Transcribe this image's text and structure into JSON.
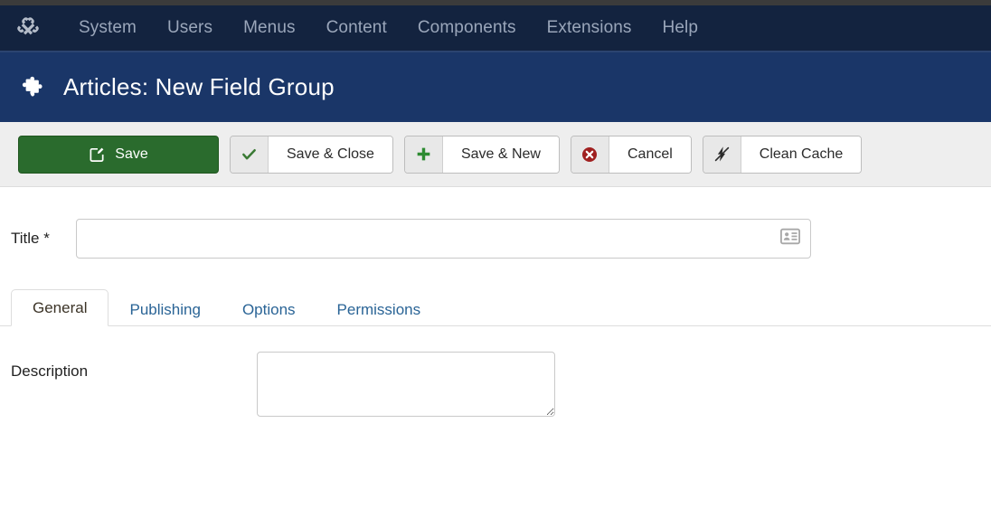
{
  "nav": {
    "logo_icon": "joomla-logo-icon",
    "items": [
      {
        "label": "System"
      },
      {
        "label": "Users"
      },
      {
        "label": "Menus"
      },
      {
        "label": "Content"
      },
      {
        "label": "Components"
      },
      {
        "label": "Extensions"
      },
      {
        "label": "Help"
      }
    ]
  },
  "header": {
    "icon": "puzzle-piece-icon",
    "title": "Articles: New Field Group"
  },
  "toolbar": {
    "buttons": [
      {
        "label": "Save",
        "icon": "edit-square-icon",
        "style": "primary"
      },
      {
        "label": "Save & Close",
        "icon": "check-icon",
        "style": "split"
      },
      {
        "label": "Save & New",
        "icon": "plus-icon",
        "style": "split"
      },
      {
        "label": "Cancel",
        "icon": "cancel-circle-icon",
        "style": "split"
      },
      {
        "label": "Clean Cache",
        "icon": "lightning-slash-icon",
        "style": "split"
      }
    ]
  },
  "form": {
    "title_field": {
      "label": "Title *",
      "value": "",
      "placeholder": "",
      "icon": "vcard-icon"
    },
    "description_field": {
      "label": "Description",
      "value": "",
      "placeholder": ""
    }
  },
  "tabs": [
    {
      "label": "General",
      "active": true
    },
    {
      "label": "Publishing",
      "active": false
    },
    {
      "label": "Options",
      "active": false
    },
    {
      "label": "Permissions",
      "active": false
    }
  ],
  "colors": {
    "top_strip": "#3b3b3b",
    "nav_bg": "#13233f",
    "header_bg": "#1a3668",
    "toolbar_bg": "#eeeeee",
    "save_green": "#2a6b2d",
    "cancel_red": "#a02020",
    "tab_link_blue": "#2a6496"
  }
}
